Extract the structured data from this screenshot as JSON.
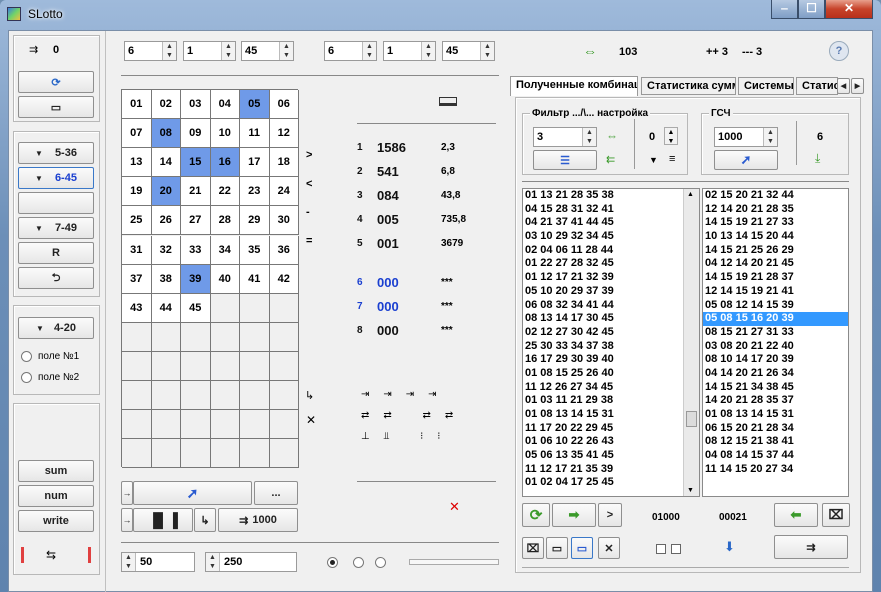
{
  "window": {
    "title": "SLotto"
  },
  "left_panel": {
    "counter": "0",
    "buttons": [
      "5-36",
      "6-45",
      "",
      "7-49",
      "R"
    ],
    "btn_4_20": "4-20",
    "radio1": "поле №1",
    "radio2": "поле №2",
    "sum": "sum",
    "num": "num",
    "write": "write"
  },
  "top_bar": {
    "spin_values": [
      "6",
      "1",
      "45",
      "6",
      "1",
      "45"
    ],
    "count": "103",
    "pp": "++ 3",
    "mm": "--- 3"
  },
  "grid": {
    "numbers": [
      "01",
      "02",
      "03",
      "04",
      "05",
      "06",
      "07",
      "08",
      "09",
      "10",
      "11",
      "12",
      "13",
      "14",
      "15",
      "16",
      "17",
      "18",
      "19",
      "20",
      "21",
      "22",
      "23",
      "24",
      "25",
      "26",
      "27",
      "28",
      "29",
      "30",
      "31",
      "32",
      "33",
      "34",
      "35",
      "36",
      "37",
      "38",
      "39",
      "40",
      "41",
      "42",
      "43",
      "44",
      "45"
    ],
    "highlighted": [
      "05",
      "08",
      "15",
      "16",
      "20",
      "39"
    ]
  },
  "compare_signs": [
    ">",
    "<",
    "-",
    "="
  ],
  "stats": [
    {
      "n": "1",
      "value": "1586",
      "ratio": "2,3",
      "color": "black"
    },
    {
      "n": "2",
      "value": "541",
      "ratio": "6,8",
      "color": "black"
    },
    {
      "n": "3",
      "value": "084",
      "ratio": "43,8",
      "color": "black"
    },
    {
      "n": "4",
      "value": "005",
      "ratio": "735,8",
      "color": "black"
    },
    {
      "n": "5",
      "value": "001",
      "ratio": "3679",
      "color": "black"
    },
    {
      "n": "6",
      "value": "000",
      "ratio": "***",
      "color": "blue"
    },
    {
      "n": "7",
      "value": "000",
      "ratio": "***",
      "color": "blue"
    },
    {
      "n": "8",
      "value": "000",
      "ratio": "***",
      "color": "black"
    }
  ],
  "bottom_left": {
    "btn_1000": "1000",
    "dots": "...",
    "spin1": "50",
    "spin2": "250"
  },
  "tabs": [
    "Полученные комбинации",
    "Статистика суммы",
    "Системы",
    "Статис"
  ],
  "filter": {
    "title": "Фильтр .../\\... настройка",
    "spin": "3",
    "value": "0"
  },
  "gsc": {
    "title": "ГСЧ",
    "spin": "1000",
    "value": "6"
  },
  "list_left": [
    "01 13 21 28 35 38",
    "04 15 28 31 32 41",
    "04 21 37 41 44 45",
    "03 10 29 32 34 45",
    "02 04 06 11 28 44",
    "01 22 27 28 32 45",
    "01 12 17 21 32 39",
    "05 10 20 29 37 39",
    "06 08 32 34 41 44",
    "08 13 14 17 30 45",
    "02 12 27 30 42 45",
    "25 30 33 34 37 38",
    "16 17 29 30 39 40",
    "01 08 15 25 26 40",
    "11 12 26 27 34 45",
    "01 03 11 21 29 38",
    "01 08 13 14 15 31",
    "11 17 20 22 29 45",
    "01 06 10 22 26 43",
    "05 06 13 35 41 45",
    "11 12 17 21 35 39",
    "01 02 04 17 25 45"
  ],
  "list_right": [
    "02 15 20 21 32 44",
    "12 14 20 21 28 35",
    "14 15 19 21 27 33",
    "10 13 14 15 20 44",
    "14 15 21 25 26 29",
    "04 12 14 20 21 45",
    "14 15 19 21 28 37",
    "12 14 15 19 21 41",
    "05 08 12 14 15 39",
    "05 08 15 16 20 39",
    "08 15 21 27 31 33",
    "03 08 20 21 22 40",
    "08 10 14 17 20 39",
    "04 14 20 21 26 34",
    "14 15 21 34 38 45",
    "14 20 21 28 35 37",
    "01 08 13 14 15 31",
    "06 15 20 21 28 34",
    "08 12 15 21 38 41",
    "04 08 14 15 37 44",
    "11 14 15 20 27 34"
  ],
  "list_right_selected": 9,
  "bottom_right": {
    "num1": "01000",
    "num2": "00021"
  }
}
